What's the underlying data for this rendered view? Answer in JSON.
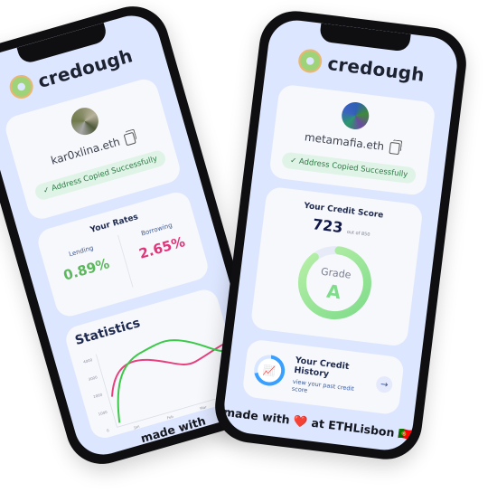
{
  "brand": {
    "name": "credough"
  },
  "left_phone": {
    "profile": {
      "name": "kar0xlina.eth",
      "copied": "Address Copied Successfully"
    },
    "rates": {
      "title": "Your Rates",
      "lending_label": "Lending",
      "lending_value": "0.89%",
      "borrowing_label": "Borrowing",
      "borrowing_value": "2.65%"
    },
    "statistics": {
      "title": "Statistics",
      "y_ticks": [
        "4000",
        "3000",
        "2000",
        "1000",
        "0"
      ],
      "x_ticks": [
        "Jan",
        "Feb",
        "Mar"
      ]
    },
    "footer": "made with"
  },
  "right_phone": {
    "profile": {
      "name": "metamafia.eth",
      "copied": "Address Copied Successfully"
    },
    "score": {
      "title": "Your Credit Score",
      "value": "723",
      "out_of": "out of 850",
      "grade_label": "Grade",
      "grade": "A"
    },
    "history": {
      "title": "Your Credit History",
      "subtitle": "view your past credit score",
      "arrow": "→"
    },
    "footer": "made with ❤️ at ETHLisbon 🇵🇹"
  },
  "colors": {
    "lending": "#5cb85c",
    "borrowing": "#e0357a",
    "green_line": "#3cc94a",
    "pink_line": "#e6407f",
    "grade": "#7fdc8a"
  }
}
